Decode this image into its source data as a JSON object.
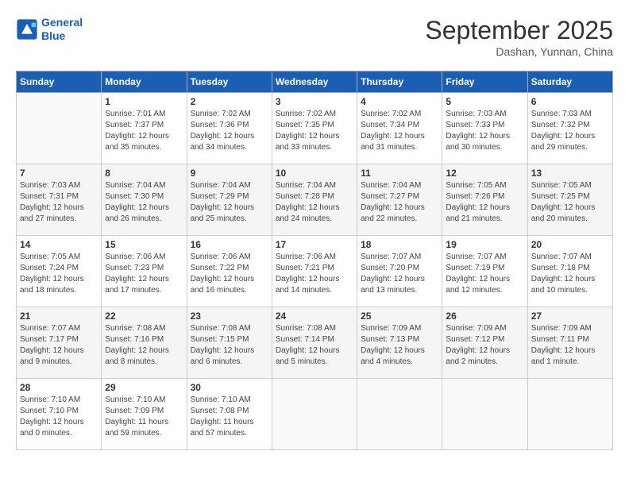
{
  "header": {
    "logo_line1": "General",
    "logo_line2": "Blue",
    "month": "September 2025",
    "location": "Dashan, Yunnan, China"
  },
  "days_of_week": [
    "Sunday",
    "Monday",
    "Tuesday",
    "Wednesday",
    "Thursday",
    "Friday",
    "Saturday"
  ],
  "weeks": [
    [
      {
        "num": "",
        "detail": ""
      },
      {
        "num": "1",
        "detail": "Sunrise: 7:01 AM\nSunset: 7:37 PM\nDaylight: 12 hours\nand 35 minutes."
      },
      {
        "num": "2",
        "detail": "Sunrise: 7:02 AM\nSunset: 7:36 PM\nDaylight: 12 hours\nand 34 minutes."
      },
      {
        "num": "3",
        "detail": "Sunrise: 7:02 AM\nSunset: 7:35 PM\nDaylight: 12 hours\nand 33 minutes."
      },
      {
        "num": "4",
        "detail": "Sunrise: 7:02 AM\nSunset: 7:34 PM\nDaylight: 12 hours\nand 31 minutes."
      },
      {
        "num": "5",
        "detail": "Sunrise: 7:03 AM\nSunset: 7:33 PM\nDaylight: 12 hours\nand 30 minutes."
      },
      {
        "num": "6",
        "detail": "Sunrise: 7:03 AM\nSunset: 7:32 PM\nDaylight: 12 hours\nand 29 minutes."
      }
    ],
    [
      {
        "num": "7",
        "detail": "Sunrise: 7:03 AM\nSunset: 7:31 PM\nDaylight: 12 hours\nand 27 minutes."
      },
      {
        "num": "8",
        "detail": "Sunrise: 7:04 AM\nSunset: 7:30 PM\nDaylight: 12 hours\nand 26 minutes."
      },
      {
        "num": "9",
        "detail": "Sunrise: 7:04 AM\nSunset: 7:29 PM\nDaylight: 12 hours\nand 25 minutes."
      },
      {
        "num": "10",
        "detail": "Sunrise: 7:04 AM\nSunset: 7:28 PM\nDaylight: 12 hours\nand 24 minutes."
      },
      {
        "num": "11",
        "detail": "Sunrise: 7:04 AM\nSunset: 7:27 PM\nDaylight: 12 hours\nand 22 minutes."
      },
      {
        "num": "12",
        "detail": "Sunrise: 7:05 AM\nSunset: 7:26 PM\nDaylight: 12 hours\nand 21 minutes."
      },
      {
        "num": "13",
        "detail": "Sunrise: 7:05 AM\nSunset: 7:25 PM\nDaylight: 12 hours\nand 20 minutes."
      }
    ],
    [
      {
        "num": "14",
        "detail": "Sunrise: 7:05 AM\nSunset: 7:24 PM\nDaylight: 12 hours\nand 18 minutes."
      },
      {
        "num": "15",
        "detail": "Sunrise: 7:06 AM\nSunset: 7:23 PM\nDaylight: 12 hours\nand 17 minutes."
      },
      {
        "num": "16",
        "detail": "Sunrise: 7:06 AM\nSunset: 7:22 PM\nDaylight: 12 hours\nand 16 minutes."
      },
      {
        "num": "17",
        "detail": "Sunrise: 7:06 AM\nSunset: 7:21 PM\nDaylight: 12 hours\nand 14 minutes."
      },
      {
        "num": "18",
        "detail": "Sunrise: 7:07 AM\nSunset: 7:20 PM\nDaylight: 12 hours\nand 13 minutes."
      },
      {
        "num": "19",
        "detail": "Sunrise: 7:07 AM\nSunset: 7:19 PM\nDaylight: 12 hours\nand 12 minutes."
      },
      {
        "num": "20",
        "detail": "Sunrise: 7:07 AM\nSunset: 7:18 PM\nDaylight: 12 hours\nand 10 minutes."
      }
    ],
    [
      {
        "num": "21",
        "detail": "Sunrise: 7:07 AM\nSunset: 7:17 PM\nDaylight: 12 hours\nand 9 minutes."
      },
      {
        "num": "22",
        "detail": "Sunrise: 7:08 AM\nSunset: 7:16 PM\nDaylight: 12 hours\nand 8 minutes."
      },
      {
        "num": "23",
        "detail": "Sunrise: 7:08 AM\nSunset: 7:15 PM\nDaylight: 12 hours\nand 6 minutes."
      },
      {
        "num": "24",
        "detail": "Sunrise: 7:08 AM\nSunset: 7:14 PM\nDaylight: 12 hours\nand 5 minutes."
      },
      {
        "num": "25",
        "detail": "Sunrise: 7:09 AM\nSunset: 7:13 PM\nDaylight: 12 hours\nand 4 minutes."
      },
      {
        "num": "26",
        "detail": "Sunrise: 7:09 AM\nSunset: 7:12 PM\nDaylight: 12 hours\nand 2 minutes."
      },
      {
        "num": "27",
        "detail": "Sunrise: 7:09 AM\nSunset: 7:11 PM\nDaylight: 12 hours\nand 1 minute."
      }
    ],
    [
      {
        "num": "28",
        "detail": "Sunrise: 7:10 AM\nSunset: 7:10 PM\nDaylight: 12 hours\nand 0 minutes."
      },
      {
        "num": "29",
        "detail": "Sunrise: 7:10 AM\nSunset: 7:09 PM\nDaylight: 11 hours\nand 59 minutes."
      },
      {
        "num": "30",
        "detail": "Sunrise: 7:10 AM\nSunset: 7:08 PM\nDaylight: 11 hours\nand 57 minutes."
      },
      {
        "num": "",
        "detail": ""
      },
      {
        "num": "",
        "detail": ""
      },
      {
        "num": "",
        "detail": ""
      },
      {
        "num": "",
        "detail": ""
      }
    ]
  ]
}
